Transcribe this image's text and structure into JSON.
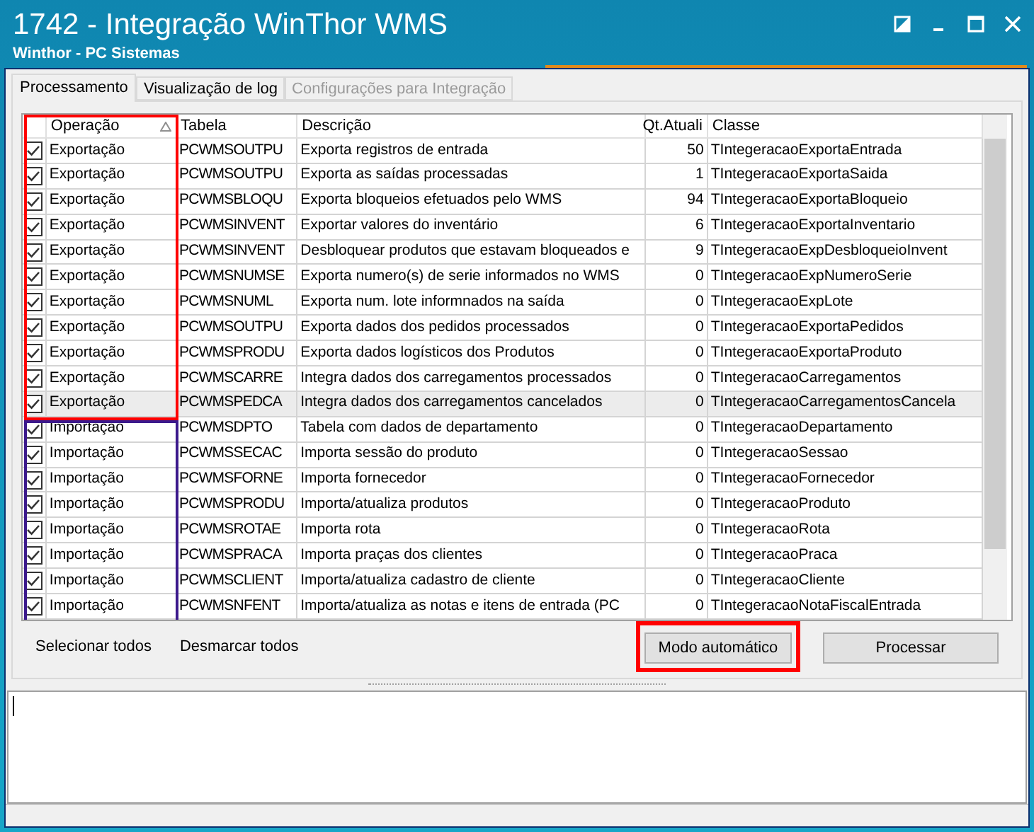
{
  "window": {
    "title": "1742 - Integração WinThor WMS",
    "subtitle": "Winthor - PC Sistemas"
  },
  "tabs": [
    {
      "label": "Processamento",
      "selected": true,
      "disabled": false
    },
    {
      "label": "Visualização de log",
      "selected": false,
      "disabled": false
    },
    {
      "label": "Configurações para Integração",
      "selected": false,
      "disabled": true
    }
  ],
  "table": {
    "columns": [
      "Operação",
      "Tabela",
      "Descrição",
      "Qt.Atuali",
      "Classe"
    ],
    "rows": [
      {
        "checked": true,
        "selected": false,
        "cells": [
          "Exportação",
          "PCWMSOUTPU",
          "Exporta registros de entrada",
          "50",
          "TIntegeracaoExportaEntrada"
        ]
      },
      {
        "checked": true,
        "selected": false,
        "cells": [
          "Exportação",
          "PCWMSOUTPU",
          "Exporta as saídas processadas",
          "1",
          "TIntegeracaoExportaSaida"
        ]
      },
      {
        "checked": true,
        "selected": false,
        "cells": [
          "Exportação",
          "PCWMSBLOQU",
          "Exporta bloqueios efetuados pelo WMS",
          "94",
          "TIntegeracaoExportaBloqueio"
        ]
      },
      {
        "checked": true,
        "selected": false,
        "cells": [
          "Exportação",
          "PCWMSINVENT",
          "Exportar valores do inventário",
          "6",
          "TIntegeracaoExportaInventario"
        ]
      },
      {
        "checked": true,
        "selected": false,
        "cells": [
          "Exportação",
          "PCWMSINVENT",
          "Desbloquear produtos que estavam bloqueados e",
          "9",
          "TIntegeracaoExpDesbloqueioInvent"
        ]
      },
      {
        "checked": true,
        "selected": false,
        "cells": [
          "Exportação",
          "PCWMSNUMSE",
          "Exporta numero(s) de serie informados no WMS",
          "0",
          "TIntegeracaoExpNumeroSerie"
        ]
      },
      {
        "checked": true,
        "selected": false,
        "cells": [
          "Exportação",
          "PCWMSNUML",
          "Exporta num. lote informnados na saída",
          "0",
          "TIntegeracaoExpLote"
        ]
      },
      {
        "checked": true,
        "selected": false,
        "cells": [
          "Exportação",
          "PCWMSOUTPU",
          "Exporta dados dos pedidos processados",
          "0",
          "TIntegeracaoExportaPedidos"
        ]
      },
      {
        "checked": true,
        "selected": false,
        "cells": [
          "Exportação",
          "PCWMSPRODU",
          "Exporta dados logísticos dos Produtos",
          "0",
          "TIntegeracaoExportaProduto"
        ]
      },
      {
        "checked": true,
        "selected": false,
        "cells": [
          "Exportação",
          "PCWMSCARRE",
          "Integra dados dos carregamentos processados",
          "0",
          "TIntegeracaoCarregamentos"
        ]
      },
      {
        "checked": true,
        "selected": true,
        "cells": [
          "Exportação",
          "PCWMSPEDCA",
          "Integra dados dos carregamentos cancelados",
          "0",
          "TIntegeracaoCarregamentosCancela"
        ]
      },
      {
        "checked": true,
        "selected": false,
        "cells": [
          "Importação",
          "PCWMSDPTO",
          "Tabela com dados de departamento",
          "0",
          "TIntegeracaoDepartamento"
        ]
      },
      {
        "checked": true,
        "selected": false,
        "cells": [
          "Importação",
          "PCWMSSECAC",
          "Importa sessão do produto",
          "0",
          "TIntegeracaoSessao"
        ]
      },
      {
        "checked": true,
        "selected": false,
        "cells": [
          "Importação",
          "PCWMSFORNE",
          "Importa fornecedor",
          "0",
          "TIntegeracaoFornecedor"
        ]
      },
      {
        "checked": true,
        "selected": false,
        "cells": [
          "Importação",
          "PCWMSPRODU",
          "Importa/atualiza produtos",
          "0",
          "TIntegeracaoProduto"
        ]
      },
      {
        "checked": true,
        "selected": false,
        "cells": [
          "Importação",
          "PCWMSROTAE",
          "Importa rota",
          "0",
          "TIntegeracaoRota"
        ]
      },
      {
        "checked": true,
        "selected": false,
        "cells": [
          "Importação",
          "PCWMSPRACA",
          "Importa praças dos clientes",
          "0",
          "TIntegeracaoPraca"
        ]
      },
      {
        "checked": true,
        "selected": false,
        "cells": [
          "Importação",
          "PCWMSCLIENT",
          "Importa/atualiza cadastro de cliente",
          "0",
          "TIntegeracaoCliente"
        ]
      },
      {
        "checked": true,
        "selected": false,
        "cells": [
          "Importação",
          "PCWMSNFENT",
          "Importa/atualiza as notas e itens de entrada (PC",
          "0",
          "TIntegeracaoNotaFiscalEntrada"
        ]
      }
    ]
  },
  "highlights": [
    {
      "color": "#ff0000"
    },
    {
      "color": "#3c1a8c"
    }
  ],
  "links": [
    "Selecionar todos",
    "Desmarcar todos"
  ],
  "buttons": [
    {
      "label": "Modo automático",
      "highlighted": true
    },
    {
      "label": "Processar",
      "highlighted": false
    }
  ]
}
